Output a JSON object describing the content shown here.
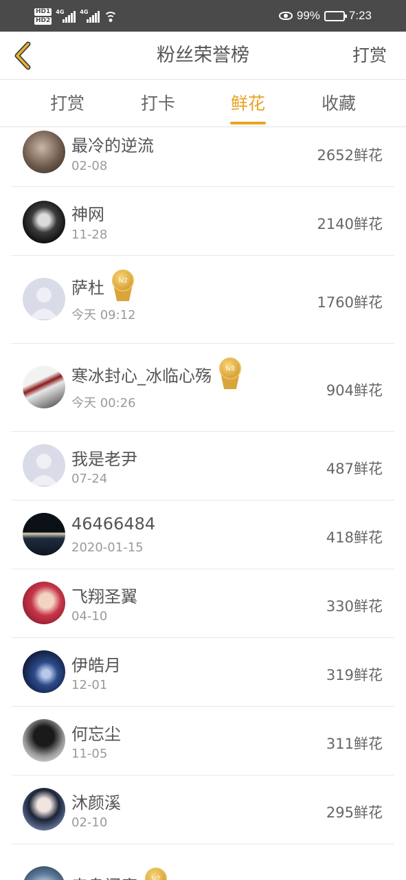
{
  "status_bar": {
    "hd1": "HD1",
    "hd2": "HD2",
    "net1": "4G",
    "net2": "4G",
    "battery": "99%",
    "time": "7:23",
    "battery_level": 0.99
  },
  "header": {
    "title": "粉丝荣誉榜",
    "right_action": "打赏",
    "back_icon": "chevron-left-icon"
  },
  "tabs": [
    {
      "label": "打赏",
      "active": false
    },
    {
      "label": "打卡",
      "active": false
    },
    {
      "label": "鲜花",
      "active": true
    },
    {
      "label": "收藏",
      "active": false
    }
  ],
  "colors": {
    "accent": "#e8a321",
    "text": "#555555",
    "subtext": "#9a9a9a",
    "status_bar": "#4a4a4a"
  },
  "rows": [
    {
      "name": "最冷的逆流",
      "date": "02-08",
      "amount": "2652鲜花",
      "badge": ""
    },
    {
      "name": "神网",
      "date": "11-28",
      "amount": "2140鲜花",
      "badge": ""
    },
    {
      "name": "萨杜",
      "date": "今天 09:12",
      "amount": "1760鲜花",
      "badge": "lv2"
    },
    {
      "name": "寒冰封心_冰临心殇",
      "date": "今天 00:26",
      "amount": "904鲜花",
      "badge": "lv3"
    },
    {
      "name": "我是老尹",
      "date": "07-24",
      "amount": "487鲜花",
      "badge": ""
    },
    {
      "name": "46466484",
      "date": "2020-01-15",
      "amount": "418鲜花",
      "badge": ""
    },
    {
      "name": "飞翔圣翼",
      "date": "04-10",
      "amount": "330鲜花",
      "badge": ""
    },
    {
      "name": "伊皓月",
      "date": "12-01",
      "amount": "319鲜花",
      "badge": ""
    },
    {
      "name": "何忘尘",
      "date": "11-05",
      "amount": "311鲜花",
      "badge": ""
    },
    {
      "name": "沐颜溪",
      "date": "02-10",
      "amount": "295鲜花",
      "badge": ""
    },
    {
      "name": "森鸟闪鹿",
      "date": "",
      "amount": "",
      "badge": "lv2"
    }
  ]
}
